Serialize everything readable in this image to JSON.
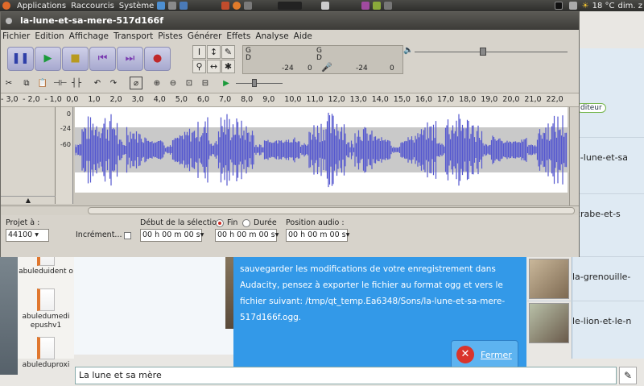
{
  "panel": {
    "menus": [
      "Applications",
      "Raccourcis",
      "Système"
    ],
    "temperature": "18 °C",
    "date": "dim. z"
  },
  "audacity": {
    "title": "la-lune-et-sa-mere-517d166f",
    "menu": [
      "Fichier",
      "Edition",
      "Affichage",
      "Transport",
      "Pistes",
      "Générer",
      "Effets",
      "Analyse",
      "Aide"
    ],
    "meters": {
      "g": "G",
      "d": "D",
      "minus24a": "-24",
      "zero": "0",
      "minus24b": "-24",
      "zero2": "0"
    },
    "ruler_ticks": [
      "- 3,0",
      "- 2,0",
      "- 1,0",
      "0,0",
      "1,0",
      "2,0",
      "3,0",
      "4,0",
      "5,0",
      "6,0",
      "7,0",
      "8,0",
      "9,0",
      "10,0",
      "11,0",
      "12,0",
      "13,0",
      "14,0",
      "15,0",
      "16,0",
      "17,0",
      "18,0",
      "19,0",
      "20,0",
      "21,0",
      "22,0"
    ],
    "vruler": [
      "0",
      "-24",
      "-60"
    ],
    "selection": {
      "projet_label": "Projet à :",
      "projet_rate": "44100",
      "increment_label": "Incrément...",
      "debut_label": "Début de la sélection",
      "fin_label": "Fin",
      "duree_label": "Durée",
      "position_label": "Position audio :",
      "time_start": "00 h 00 m 00 s",
      "time_end": "00 h 00 m 00 s",
      "time_pos": "00 h 00 m 00 s"
    }
  },
  "abuledu": {
    "editeur_badge": "diteur",
    "files": [
      "abuleduident o",
      "abuledumedi epushv1",
      "abuleduproxi"
    ],
    "stories": [
      "la-lune-et-sa",
      "-crabe-et-s",
      "la-grenouille-",
      "le-lion-et-le-n"
    ],
    "message": "sauvegarder les modifications de votre enregistrement dans Audacity, pensez à exporter le fichier au format ogg et vers le fichier suivant: /tmp/qt_temp.Ea6348/Sons/la-lune-et-sa-mere-517d166f.ogg.",
    "fermer": "Fermer",
    "title_input": "La lune et sa mère"
  }
}
